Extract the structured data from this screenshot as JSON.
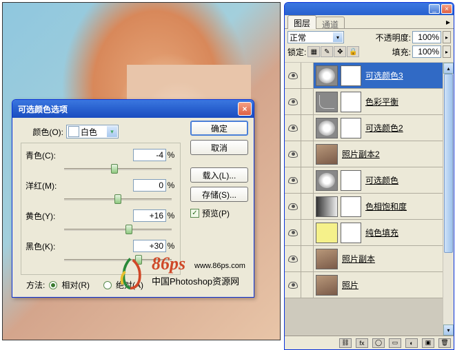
{
  "dialog": {
    "title": "可选颜色选项",
    "color_label": "颜色(O):",
    "color_value": "白色",
    "sliders": {
      "cyan": {
        "label": "青色(C):",
        "value": "-4",
        "pos": 47
      },
      "magenta": {
        "label": "洋红(M):",
        "value": "0",
        "pos": 50
      },
      "yellow": {
        "label": "黄色(Y):",
        "value": "+16",
        "pos": 60
      },
      "black": {
        "label": "黑色(K):",
        "value": "+30",
        "pos": 69
      }
    },
    "method_label": "方法:",
    "relative": "相对(R)",
    "absolute": "绝对(A)",
    "buttons": {
      "ok": "确定",
      "cancel": "取消",
      "load": "载入(L)...",
      "save": "存储(S)..."
    },
    "preview": "预览(P)",
    "pct": "%"
  },
  "watermark": {
    "big": "86ps",
    "url": "www.86ps.com",
    "sub": "中国Photoshop资源网"
  },
  "panel": {
    "tabs": {
      "layers": "图层",
      "channels": "通道"
    },
    "blend_mode": "正常",
    "opacity_label": "不透明度:",
    "opacity_value": "100%",
    "lock_label": "锁定:",
    "fill_label": "填充:",
    "fill_value": "100%",
    "layers": [
      {
        "name": "可选颜色3",
        "type": "adj",
        "mask": true,
        "selected": true,
        "underline": true
      },
      {
        "name": "色彩平衡",
        "type": "curve",
        "mask": true,
        "underline": true
      },
      {
        "name": "可选颜色2",
        "type": "adj",
        "mask": true,
        "underline": true
      },
      {
        "name": "照片副本2",
        "type": "photo",
        "mask": false,
        "underline": true
      },
      {
        "name": "可选颜色",
        "type": "adj",
        "mask": true,
        "underline": true
      },
      {
        "name": "色相饱和度",
        "type": "grad",
        "mask": true,
        "underline": true
      },
      {
        "name": "纯色填充",
        "type": "yellow",
        "mask": true,
        "underline": true
      },
      {
        "name": "照片副本",
        "type": "photo",
        "mask": false,
        "underline": true
      },
      {
        "name": "照片",
        "type": "photo",
        "mask": false,
        "underline": true
      }
    ]
  }
}
